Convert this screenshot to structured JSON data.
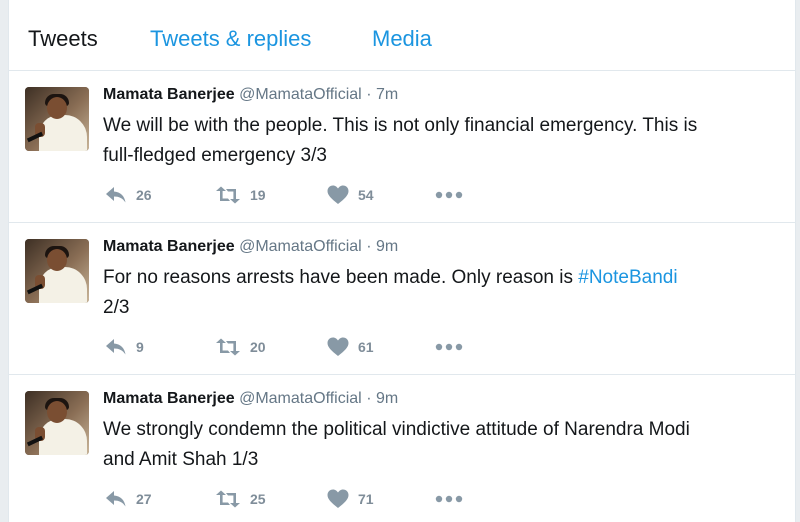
{
  "tabs": [
    {
      "label": "Tweets"
    },
    {
      "label": "Tweets & replies"
    },
    {
      "label": "Media"
    }
  ],
  "colors": {
    "link": "#1b95e0",
    "icon": "#8899a6",
    "text": "#14171a",
    "muted": "#657786"
  },
  "tweets": [
    {
      "name": "Mamata Banerjee",
      "handle": "@MamataOfficial",
      "dot": "·",
      "time": "7m",
      "text_line1": "We will be with the people. This is not only financial emergency. This is",
      "text_line2": "full-fledged emergency 3/3",
      "hashtag": "",
      "text_after": "",
      "replies": "26",
      "retweets": "19",
      "likes": "54"
    },
    {
      "name": "Mamata Banerjee",
      "handle": "@MamataOfficial",
      "dot": "·",
      "time": "9m",
      "text_line1": "For no reasons arrests have been made. Only reason is ",
      "hashtag": "#NoteBandi",
      "text_line2": "2/3",
      "text_after": "",
      "replies": "9",
      "retweets": "20",
      "likes": "61"
    },
    {
      "name": "Mamata Banerjee",
      "handle": "@MamataOfficial",
      "dot": "·",
      "time": "9m",
      "text_line1": "We strongly condemn the political vindictive attitude of Narendra Modi",
      "text_line2": "and Amit Shah 1/3",
      "hashtag": "",
      "text_after": "",
      "replies": "27",
      "retweets": "25",
      "likes": "71"
    }
  ],
  "icons": {
    "reply": "reply-icon",
    "retweet": "retweet-icon",
    "like": "heart-icon",
    "more": "more-icon"
  }
}
